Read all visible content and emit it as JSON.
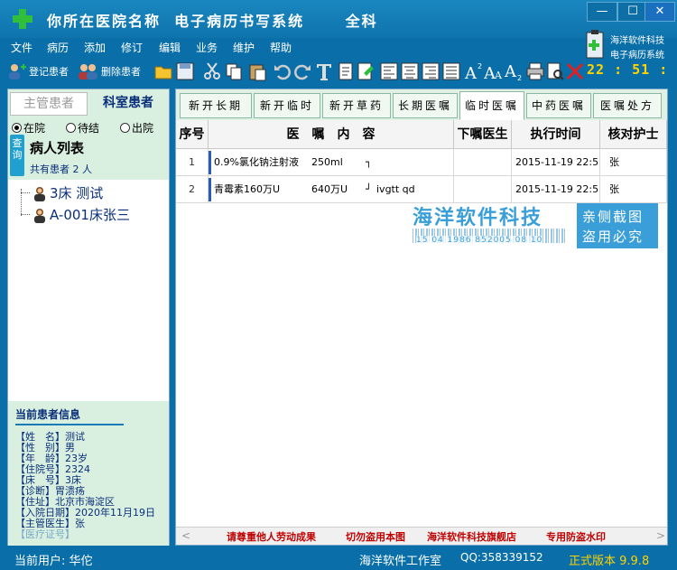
{
  "window": {
    "title": "你所在医院名称  电子病历书写系统      全科",
    "minimize": "—",
    "maximize": "☐",
    "close": "✕"
  },
  "brand": {
    "name": "海洋软件科技",
    "sub": "电子病历系统"
  },
  "clock": "22 : 51 : 29",
  "menu": [
    "文件",
    "病历",
    "添加",
    "修订",
    "编辑",
    "业务",
    "维护",
    "帮助"
  ],
  "toolbar": {
    "register": "登记患者",
    "delete": "删除患者"
  },
  "left": {
    "tabs": [
      "主管患者",
      "科室患者"
    ],
    "radios": [
      "在院",
      "待结",
      "出院"
    ],
    "query": "查询",
    "list_title": "病人列表",
    "count": "共有患者 2 人",
    "patients": [
      "3床   测试",
      "A-001床张三"
    ],
    "info_title": "当前患者信息",
    "info": [
      "【姓　名】测试",
      "【性　别】男",
      "【年　龄】23岁",
      "【住院号】2324",
      "【床　号】3床",
      "【诊断】胃溃疡",
      "【住址】北京市海淀区",
      "【入院日期】2020年11月19日",
      "【主管医生】张",
      "【医疗证号】"
    ]
  },
  "tabs": [
    "新开长期",
    "新开临时",
    "新开草药",
    "长期医嘱",
    "临时医嘱",
    "中药医嘱",
    "医嘱处方"
  ],
  "active_tab": "临时医嘱",
  "grid": {
    "headers": [
      "序号",
      "医　嘱　内　容",
      "下嘱医生",
      "执行时间",
      "核对护士"
    ],
    "rows": [
      {
        "no": "1",
        "drug": "0.9%氯化钠注射液",
        "dose": "250ml",
        "mark": "┐",
        "usage": "",
        "doctor": "",
        "time": "2015-11-19 22:55",
        "nurse": "张"
      },
      {
        "no": "2",
        "drug": "青霉素160万U",
        "dose": "640万U",
        "mark": "┘",
        "usage": "ivgtt qd",
        "doctor": "",
        "time": "2015-11-19 22:55",
        "nurse": "张"
      }
    ]
  },
  "watermark": {
    "name": "海洋软件科技",
    "code": "15 04 1986 852005 08 10",
    "line1": "亲侧截图",
    "line2": "盗用必究"
  },
  "notices": [
    "请尊重他人劳动成果",
    "切勿盗用本图",
    "海洋软件科技旗舰店",
    "专用防盗水印"
  ],
  "status": {
    "user": "当前用户: 华佗",
    "studio": "海洋软件工作室",
    "qq": "QQ:358339152",
    "version": "正式版本 9.9.8"
  },
  "colors": {
    "window_bg": "#0a6fa8",
    "panel_green": "#d9efe0",
    "clock": "#ffd200",
    "notice": "#c00000"
  }
}
